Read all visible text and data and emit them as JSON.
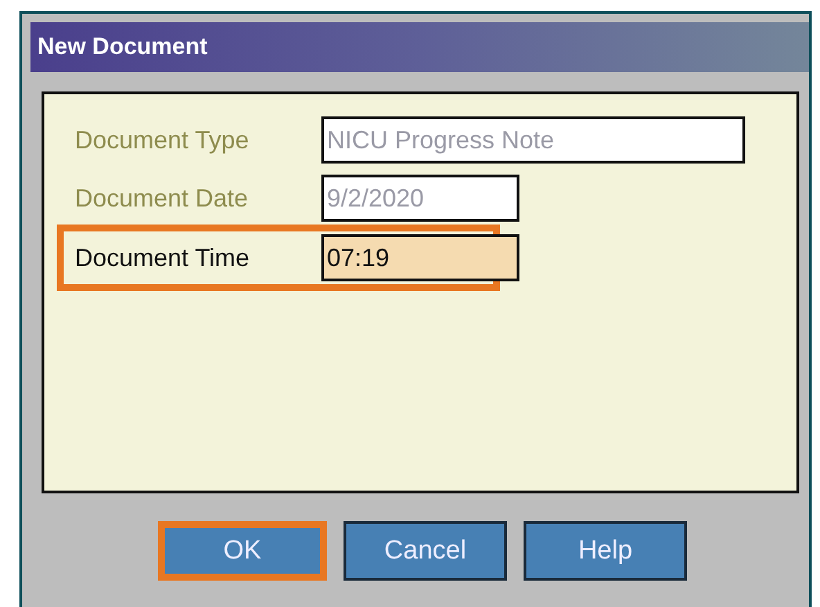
{
  "window": {
    "title": "New Document"
  },
  "fields": [
    {
      "label": "Document Type",
      "value": "NICU Progress Note",
      "disabled": true,
      "highlighted": false,
      "wide": true
    },
    {
      "label": "Document Date",
      "value": "9/2/2020",
      "disabled": true,
      "highlighted": false,
      "wide": false
    },
    {
      "label": "Document Time",
      "value": "07:19",
      "disabled": false,
      "highlighted": true,
      "wide": false
    }
  ],
  "buttons": [
    {
      "label": "OK",
      "highlighted": true
    },
    {
      "label": "Cancel",
      "highlighted": false
    },
    {
      "label": "Help",
      "highlighted": false
    }
  ]
}
